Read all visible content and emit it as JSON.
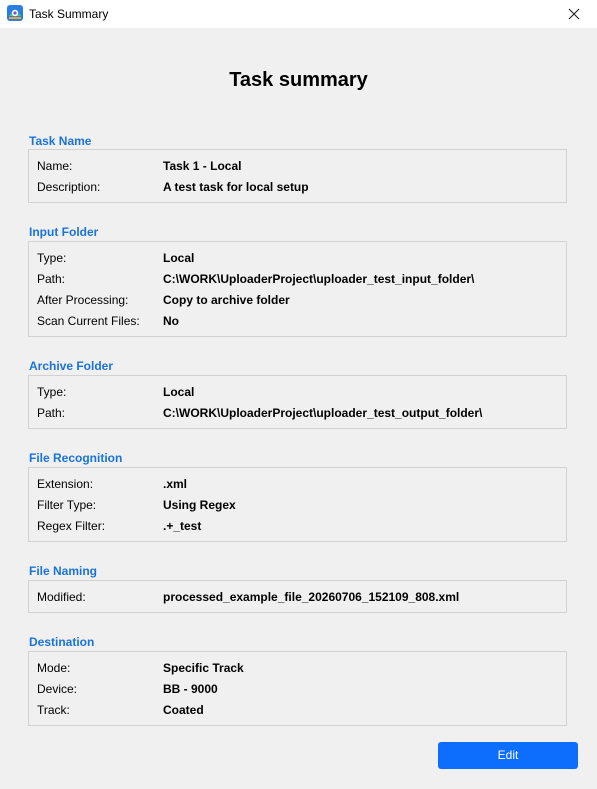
{
  "window": {
    "title": "Task Summary",
    "close_icon": "close-icon",
    "app_icon": "app-logo-icon"
  },
  "page_title": "Task summary",
  "sections": {
    "task_name": {
      "title": "Task Name",
      "rows": [
        {
          "label": "Name:",
          "value": "Task 1 - Local"
        },
        {
          "label": "Description:",
          "value": "A test task for local setup"
        }
      ]
    },
    "input_folder": {
      "title": "Input Folder",
      "rows": [
        {
          "label": "Type:",
          "value": "Local"
        },
        {
          "label": "Path:",
          "value": "C:\\WORK\\UploaderProject\\uploader_test_input_folder\\"
        },
        {
          "label": "After Processing:",
          "value": "Copy to archive folder"
        },
        {
          "label": "Scan Current Files:",
          "value": "No"
        }
      ]
    },
    "archive_folder": {
      "title": "Archive Folder",
      "rows": [
        {
          "label": "Type:",
          "value": "Local"
        },
        {
          "label": "Path:",
          "value": "C:\\WORK\\UploaderProject\\uploader_test_output_folder\\"
        }
      ]
    },
    "file_recognition": {
      "title": "File Recognition",
      "rows": [
        {
          "label": "Extension:",
          "value": ".xml"
        },
        {
          "label": "Filter Type:",
          "value": "Using Regex"
        },
        {
          "label": "Regex Filter:",
          "value": ".+_test"
        }
      ]
    },
    "file_naming": {
      "title": "File Naming",
      "rows": [
        {
          "label": "Modified:",
          "value": "processed_example_file_20260706_152109_808.xml"
        }
      ]
    },
    "destination": {
      "title": "Destination",
      "rows": [
        {
          "label": "Mode:",
          "value": "Specific Track"
        },
        {
          "label": "Device:",
          "value": "BB - 9000"
        },
        {
          "label": "Track:",
          "value": "Coated"
        }
      ]
    }
  },
  "edit_button_label": "Edit",
  "colors": {
    "section_title": "#1a73d9",
    "edit_button": "#0d6efd",
    "background": "#f0f0f0"
  }
}
